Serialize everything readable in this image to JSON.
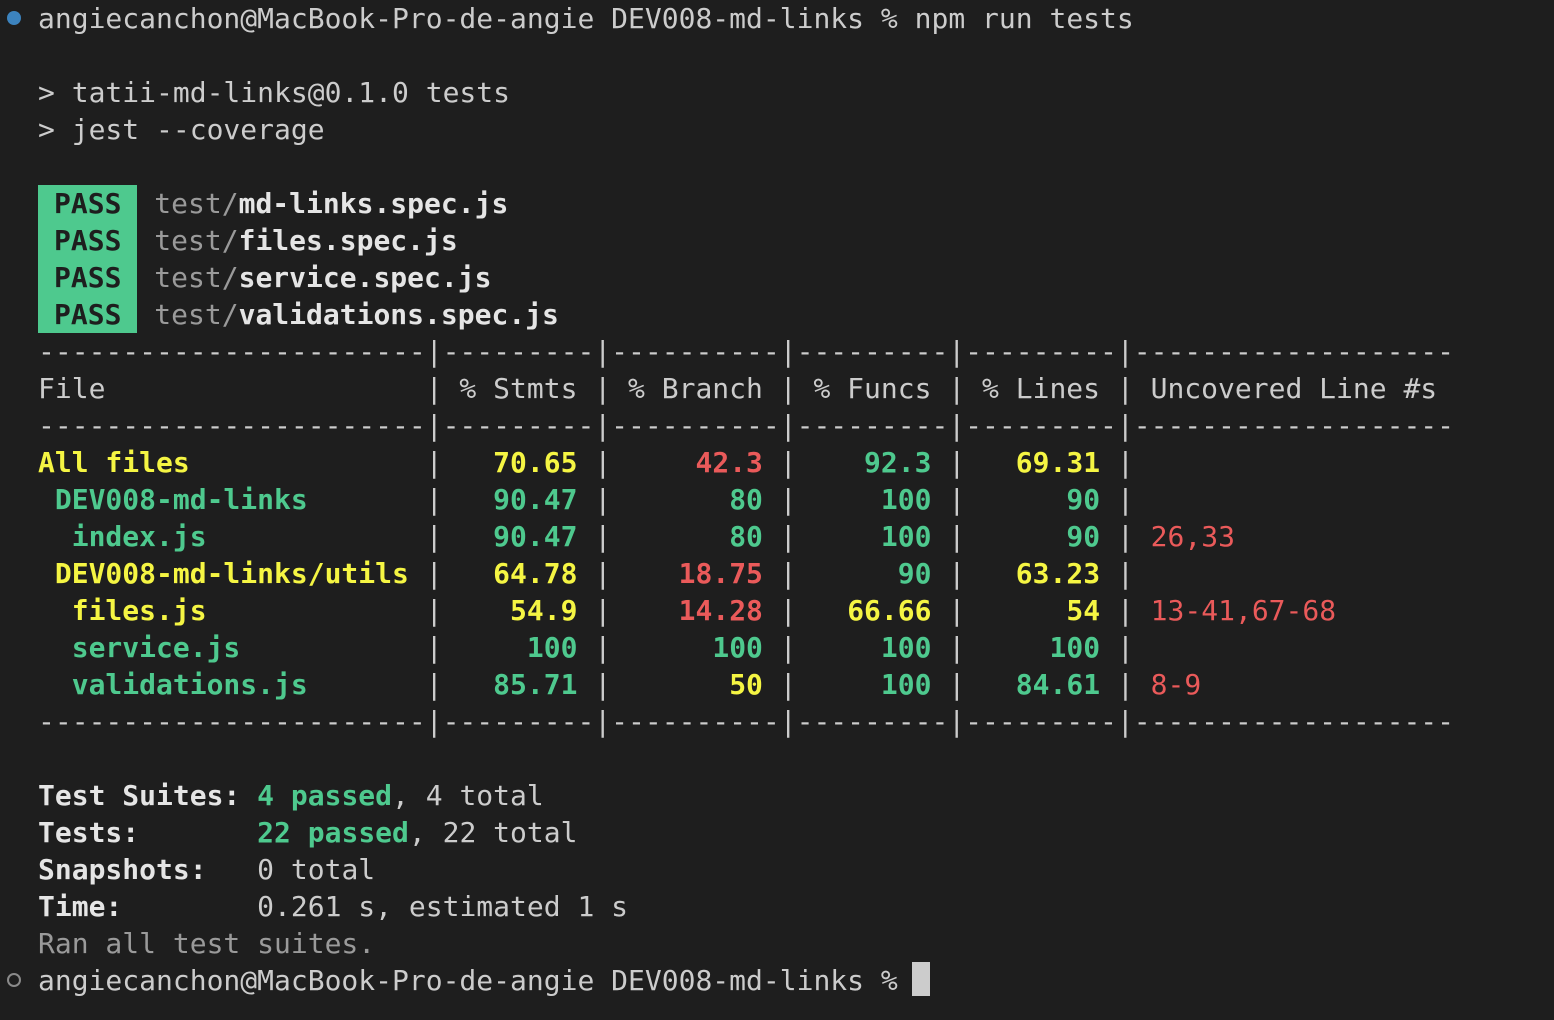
{
  "prompt": {
    "user_host": "angiecanchon@MacBook-Pro-de-angie",
    "cwd": "DEV008-md-links",
    "symbol": "%",
    "command": "npm run tests"
  },
  "script_echo": {
    "line1": "> tatii-md-links@0.1.0 tests",
    "line2": "> jest --coverage"
  },
  "pass_results": [
    {
      "badge": "PASS",
      "dir": "test/",
      "file": "md-links.spec.js"
    },
    {
      "badge": "PASS",
      "dir": "test/",
      "file": "files.spec.js"
    },
    {
      "badge": "PASS",
      "dir": "test/",
      "file": "service.spec.js"
    },
    {
      "badge": "PASS",
      "dir": "test/",
      "file": "validations.spec.js"
    }
  ],
  "coverage_table": {
    "separator": "-----------------------|---------|----------|---------|---------|-------------------",
    "header": "File                   | % Stmts | % Branch | % Funcs | % Lines | Uncovered Line #s ",
    "rows": [
      {
        "file": "All files",
        "indent": 0,
        "file_color": "yellow",
        "stmts": "70.65",
        "stmts_color": "yellow",
        "branch": "42.3",
        "branch_color": "red",
        "funcs": "92.3",
        "funcs_color": "green",
        "lines": "69.31",
        "lines_color": "yellow",
        "uncovered": ""
      },
      {
        "file": "DEV008-md-links",
        "indent": 1,
        "file_color": "green",
        "stmts": "90.47",
        "stmts_color": "green",
        "branch": "80",
        "branch_color": "green",
        "funcs": "100",
        "funcs_color": "green",
        "lines": "90",
        "lines_color": "green",
        "uncovered": ""
      },
      {
        "file": "index.js",
        "indent": 2,
        "file_color": "green",
        "stmts": "90.47",
        "stmts_color": "green",
        "branch": "80",
        "branch_color": "green",
        "funcs": "100",
        "funcs_color": "green",
        "lines": "90",
        "lines_color": "green",
        "uncovered": "26,33"
      },
      {
        "file": "DEV008-md-links/utils",
        "indent": 1,
        "file_color": "yellow",
        "stmts": "64.78",
        "stmts_color": "yellow",
        "branch": "18.75",
        "branch_color": "red",
        "funcs": "90",
        "funcs_color": "green",
        "lines": "63.23",
        "lines_color": "yellow",
        "uncovered": ""
      },
      {
        "file": "files.js",
        "indent": 2,
        "file_color": "yellow",
        "stmts": "54.9",
        "stmts_color": "yellow",
        "branch": "14.28",
        "branch_color": "red",
        "funcs": "66.66",
        "funcs_color": "yellow",
        "lines": "54",
        "lines_color": "yellow",
        "uncovered": "13-41,67-68"
      },
      {
        "file": "service.js",
        "indent": 2,
        "file_color": "green",
        "stmts": "100",
        "stmts_color": "green",
        "branch": "100",
        "branch_color": "green",
        "funcs": "100",
        "funcs_color": "green",
        "lines": "100",
        "lines_color": "green",
        "uncovered": ""
      },
      {
        "file": "validations.js",
        "indent": 2,
        "file_color": "green",
        "stmts": "85.71",
        "stmts_color": "green",
        "branch": "50",
        "branch_color": "yellow",
        "funcs": "100",
        "funcs_color": "green",
        "lines": "84.61",
        "lines_color": "green",
        "uncovered": "8-9"
      }
    ]
  },
  "summary": {
    "suites_label": "Test Suites:",
    "suites_passed": "4 passed",
    "suites_total": ", 4 total",
    "tests_label": "Tests:",
    "tests_passed": "22 passed",
    "tests_total": ", 22 total",
    "snapshots_label": "Snapshots:",
    "snapshots_value": "0 total",
    "time_label": "Time:",
    "time_value": "0.261 s, estimated 1 s",
    "ran_all": "Ran all test suites."
  },
  "colors": {
    "background": "#1e1e1e",
    "green": "#4ec98e",
    "yellow": "#f5f543",
    "red": "#ea5a5a",
    "prompt_dot": "#3c83be"
  }
}
